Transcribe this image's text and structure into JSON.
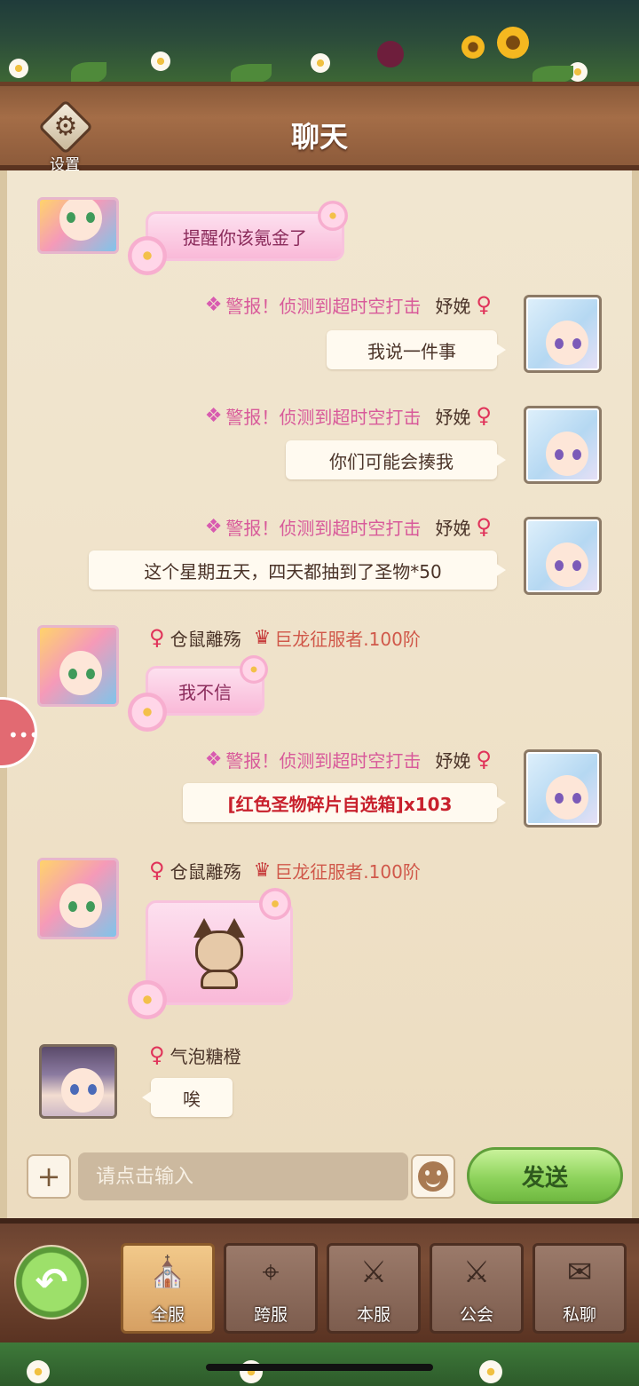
{
  "header": {
    "title": "聊天",
    "settings_label": "设置",
    "settings_icon": "gear-icon"
  },
  "messages": [
    {
      "side": "left",
      "avatar": "pink",
      "sender": "",
      "text": "提醒你该氪金了",
      "bubble": "pink"
    },
    {
      "side": "right",
      "avatar": "blue",
      "sender": "妤娩",
      "gender": "♀",
      "title": "警报！侦测到超时空打击",
      "text": "我说一件事"
    },
    {
      "side": "right",
      "avatar": "blue",
      "sender": "妤娩",
      "gender": "♀",
      "title": "警报！侦测到超时空打击",
      "text": "你们可能会揍我"
    },
    {
      "side": "right",
      "avatar": "blue",
      "sender": "妤娩",
      "gender": "♀",
      "title": "警报！侦测到超时空打击",
      "text": "这个星期五天，四天都抽到了圣物*50"
    },
    {
      "side": "left",
      "avatar": "pink",
      "sender": "仓鼠離殇",
      "gender": "♀",
      "title": "巨龙征服者.100阶",
      "text": "我不信",
      "bubble": "pink"
    },
    {
      "side": "right",
      "avatar": "blue",
      "sender": "妤娩",
      "gender": "♀",
      "title": "警报！侦测到超时空打击",
      "item_text": "[红色圣物碎片自选箱]",
      "item_count": "x103"
    },
    {
      "side": "left",
      "avatar": "pink",
      "sender": "仓鼠離殇",
      "gender": "♀",
      "title": "巨龙征服者.100阶",
      "sticker": "fox-sticker",
      "bubble": "pink"
    },
    {
      "side": "left",
      "avatar": "dark",
      "sender": "气泡糖橙",
      "gender": "♀",
      "text": "唉"
    }
  ],
  "input": {
    "placeholder": "请点击输入",
    "plus_label": "+",
    "send_label": "发送"
  },
  "tabs": [
    {
      "label": "全服",
      "icon": "castle-icon",
      "active": true
    },
    {
      "label": "跨服",
      "icon": "map-pin-icon",
      "active": false
    },
    {
      "label": "本服",
      "icon": "swords-banner-icon",
      "active": false
    },
    {
      "label": "公会",
      "icon": "guild-banner-icon",
      "active": false
    },
    {
      "label": "私聊",
      "icon": "chat-bubble-icon",
      "active": false
    }
  ],
  "colors": {
    "female": "#e0335a",
    "title_pink": "#d85a9a",
    "title_red": "#d0584a",
    "item_link": "#c8202c",
    "send_green": "#8ed35c"
  }
}
